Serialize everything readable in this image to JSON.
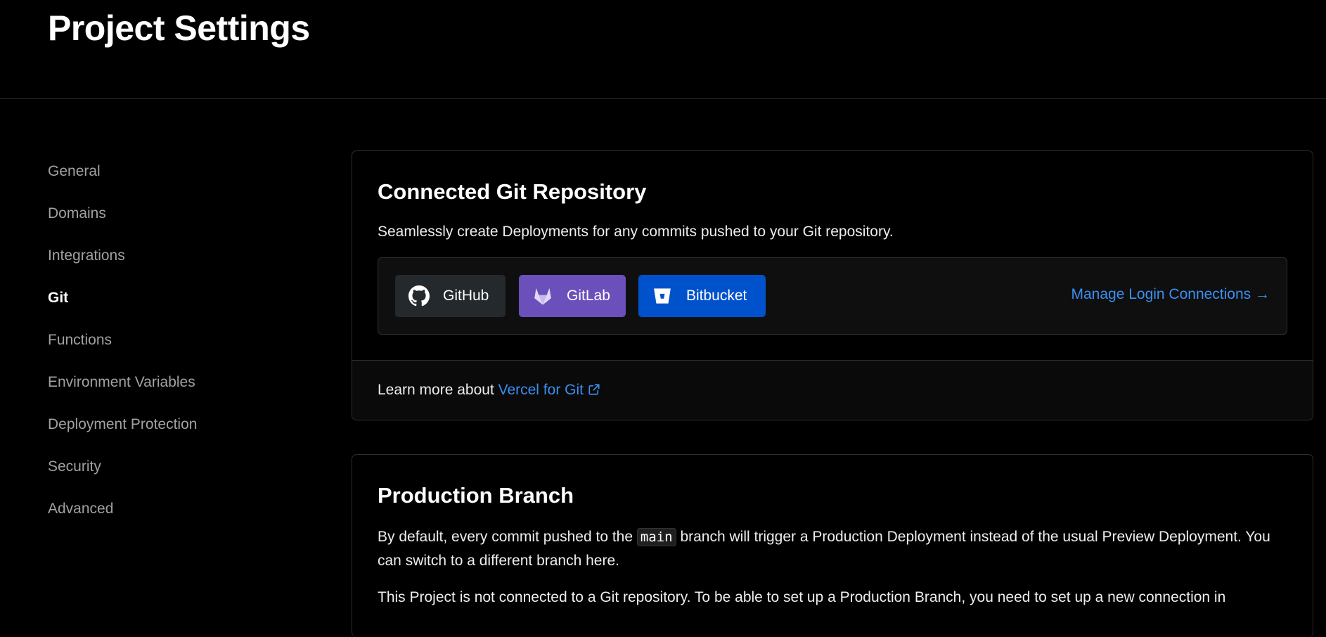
{
  "header": {
    "title": "Project Settings"
  },
  "sidebar": {
    "items": [
      {
        "label": "General",
        "active": false
      },
      {
        "label": "Domains",
        "active": false
      },
      {
        "label": "Integrations",
        "active": false
      },
      {
        "label": "Git",
        "active": true
      },
      {
        "label": "Functions",
        "active": false
      },
      {
        "label": "Environment Variables",
        "active": false
      },
      {
        "label": "Deployment Protection",
        "active": false
      },
      {
        "label": "Security",
        "active": false
      },
      {
        "label": "Advanced",
        "active": false
      }
    ]
  },
  "git_card": {
    "title": "Connected Git Repository",
    "description": "Seamlessly create Deployments for any commits pushed to your Git repository.",
    "providers": [
      {
        "label": "GitHub",
        "icon": "github-icon",
        "color": "#24292e"
      },
      {
        "label": "GitLab",
        "icon": "gitlab-icon",
        "color": "#6b4fbb"
      },
      {
        "label": "Bitbucket",
        "icon": "bitbucket-icon",
        "color": "#0052cc"
      }
    ],
    "manage_link": "Manage Login Connections →",
    "footer_prefix": "Learn more about ",
    "footer_link": "Vercel for Git"
  },
  "prod_card": {
    "title": "Production Branch",
    "desc_before": "By default, every commit pushed to the ",
    "branch": "main",
    "desc_after": " branch will trigger a Production Deployment instead of the usual Preview Deployment. You can switch to a different branch here.",
    "note": "This Project is not connected to a Git repository. To be able to set up a Production Branch, you need to set up a new connection in"
  },
  "colors": {
    "accent_link": "#3b8ef0",
    "background": "#000000"
  }
}
